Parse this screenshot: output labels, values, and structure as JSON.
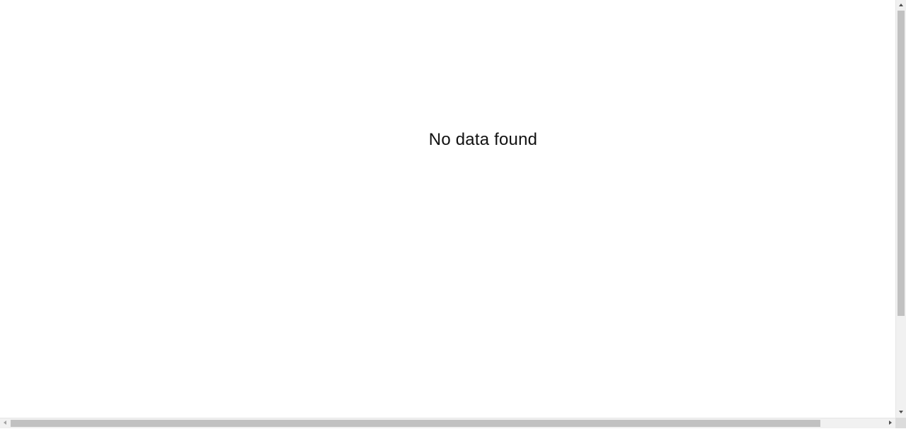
{
  "main": {
    "empty_message": "No data found"
  },
  "scrollbars": {
    "vertical_position": 0,
    "horizontal_position": 0
  },
  "colors": {
    "background": "#ffffff",
    "text": "#111111",
    "scrollbar_track": "#f1f1f1",
    "scrollbar_thumb": "#c1c1c1"
  }
}
